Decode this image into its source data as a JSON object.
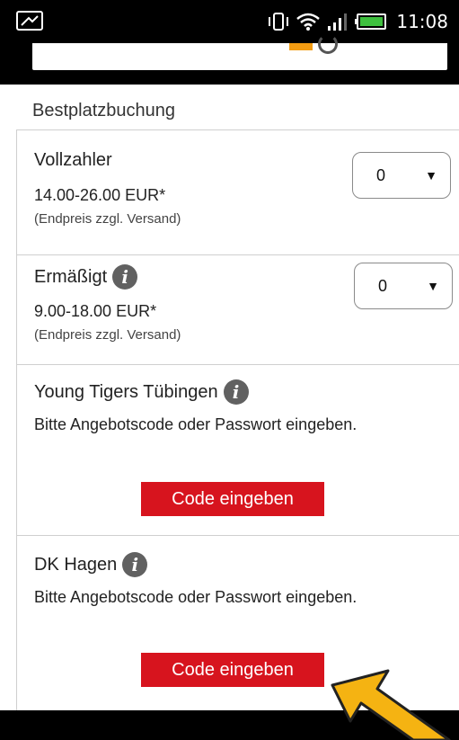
{
  "status_bar": {
    "time": "11:08"
  },
  "section_title": "Bestplatzbuchung",
  "cards": [
    {
      "label": "Vollzahler",
      "price": "14.00-26.00 EUR*",
      "note": "(Endpreis zzgl. Versand)",
      "quantity": "0"
    },
    {
      "label": "Ermäßigt",
      "price": "9.00-18.00 EUR*",
      "note": "(Endpreis zzgl. Versand)",
      "quantity": "0"
    },
    {
      "label": "Young Tigers Tübingen",
      "description": "Bitte Angebotscode oder Passwort eingeben.",
      "button": "Code eingeben"
    },
    {
      "label": "DK Hagen",
      "description": "Bitte Angebotscode oder Passwort eingeben.",
      "button": "Code eingeben"
    }
  ],
  "colors": {
    "accent_red": "#d7141e",
    "info_grey": "#616161",
    "arrow_yellow": "#f5b312"
  }
}
